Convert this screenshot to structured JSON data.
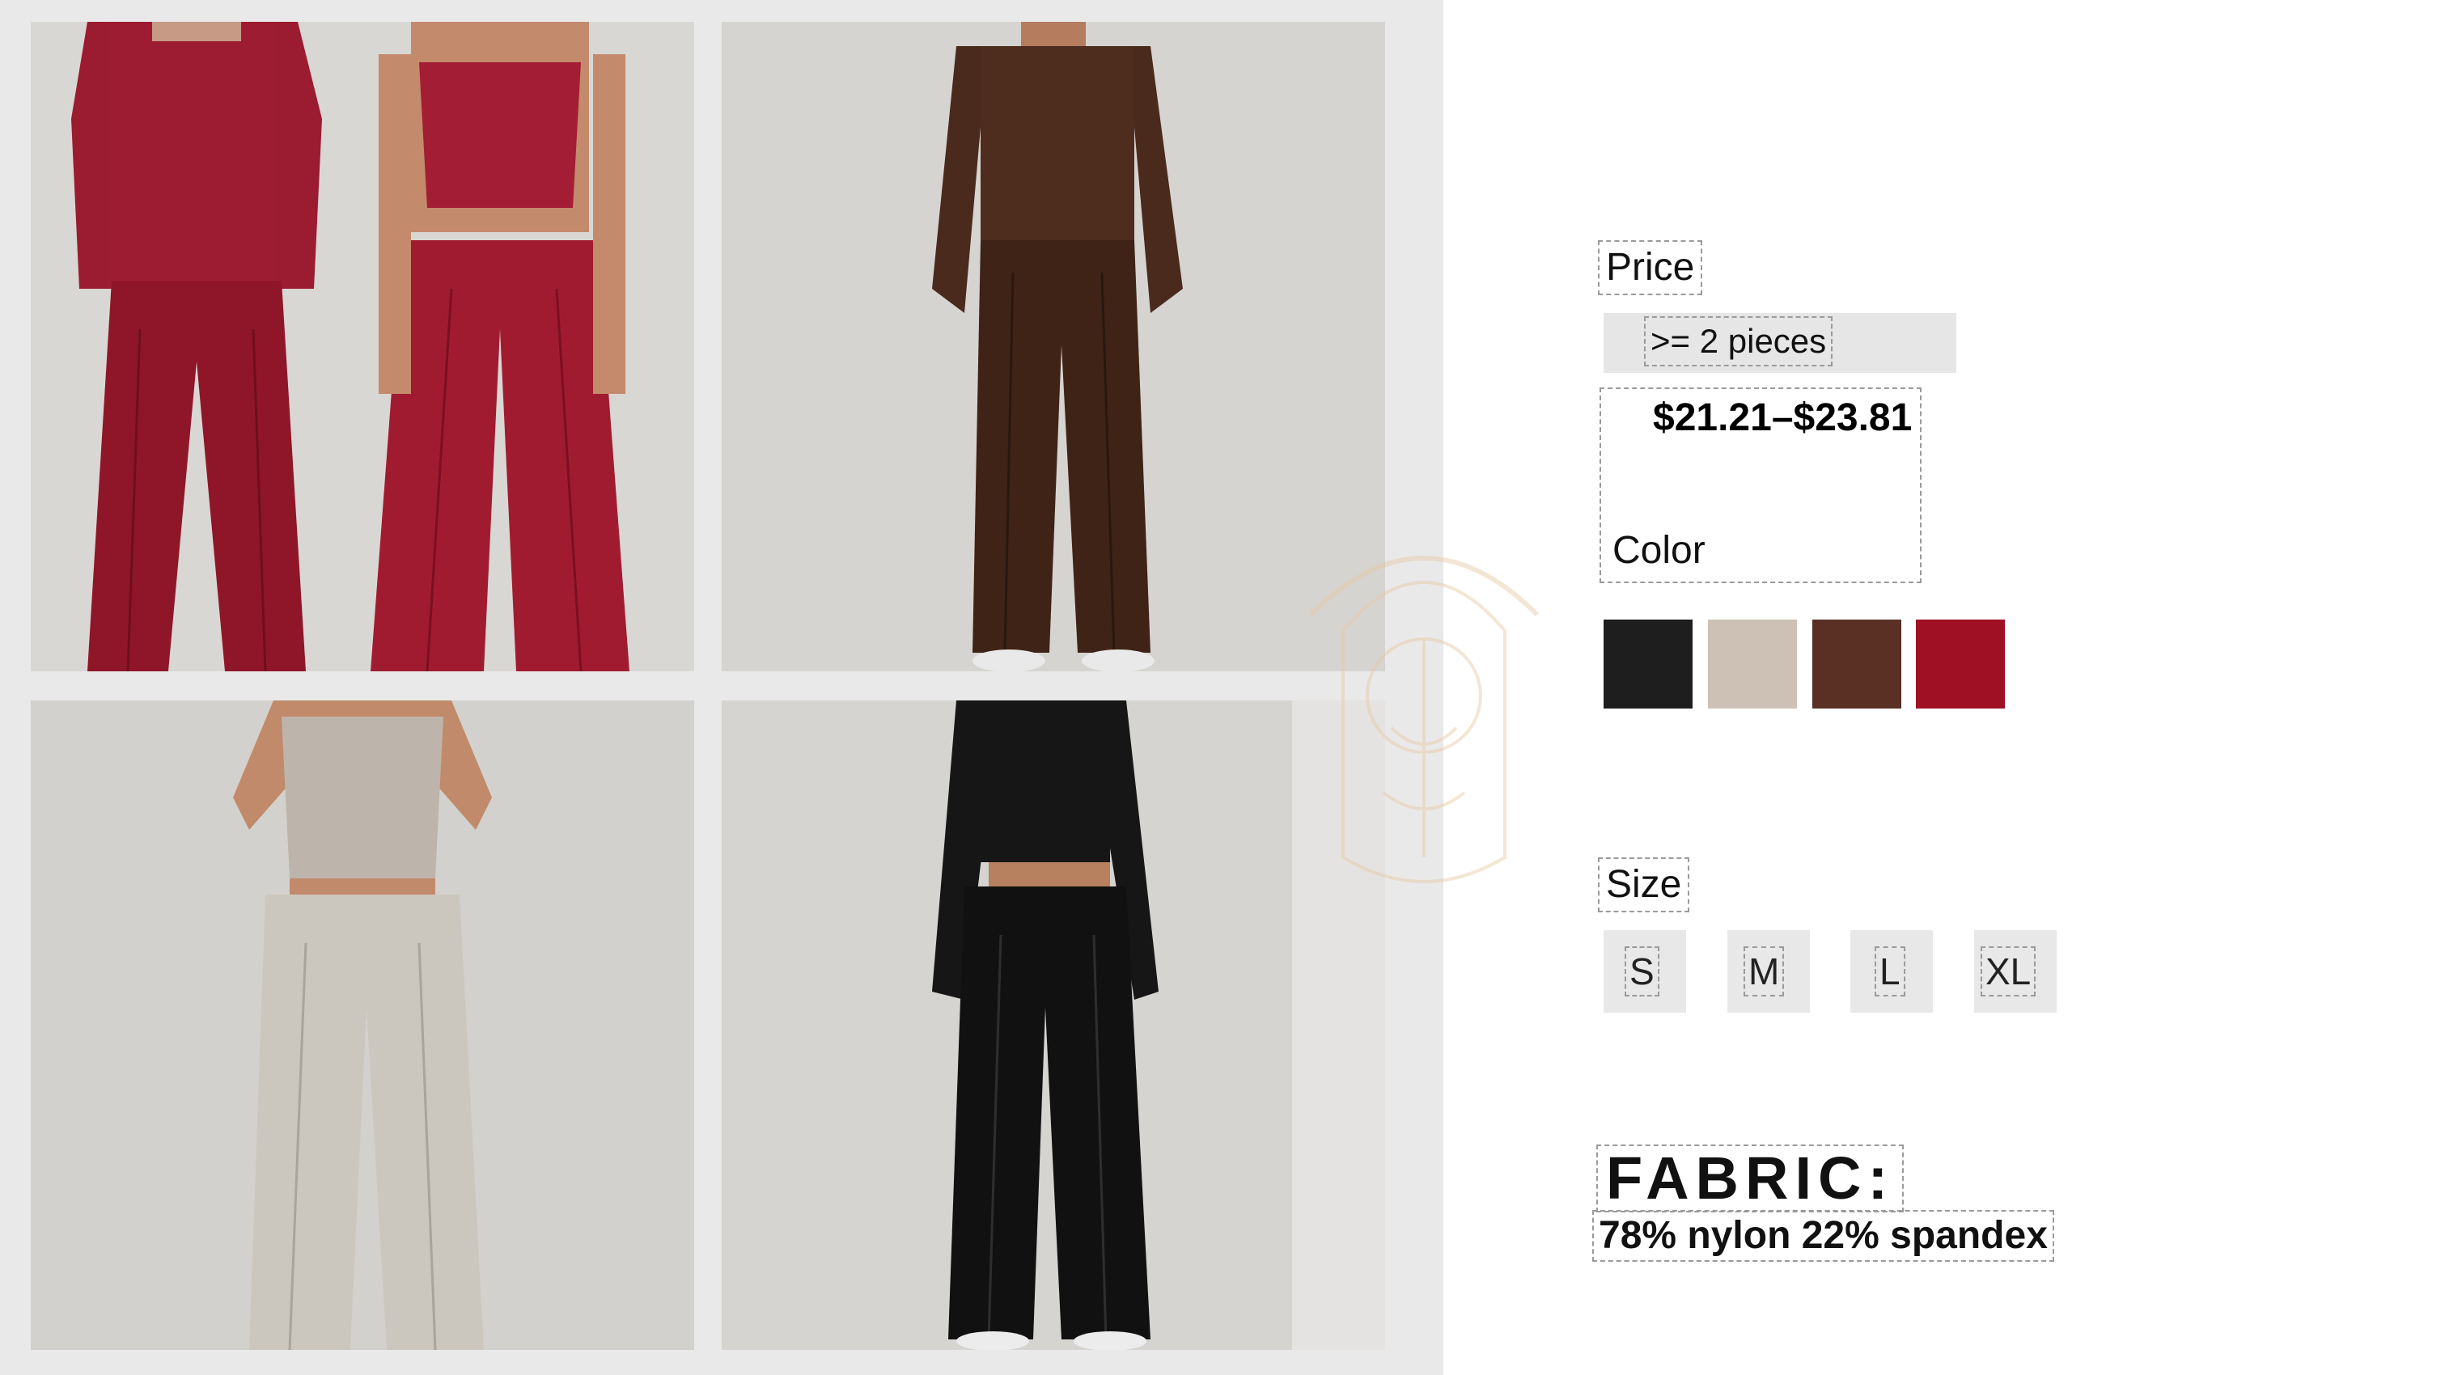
{
  "gallery": {
    "photos": [
      {
        "name": "wine-red-sweatshirt-and-tank-sets",
        "color": "#9b1b30"
      },
      {
        "name": "brown-sweatshirt-set",
        "color": "#4a2a1c"
      },
      {
        "name": "light-gray-tank-set",
        "color": "#cfcbc4"
      },
      {
        "name": "black-long-sleeve-set",
        "color": "#161616"
      }
    ]
  },
  "price": {
    "label": "Price",
    "tier_label": ">= 2 pieces",
    "range": "$21.21–$23.81"
  },
  "color": {
    "label": "Color",
    "swatches": [
      "#1e1e1e",
      "#cdc1b5",
      "#5a3024",
      "#a01025"
    ]
  },
  "size": {
    "label": "Size",
    "options": [
      "S",
      "M",
      "L",
      "XL"
    ]
  },
  "fabric": {
    "title": "FABRIC:",
    "composition": "78% nylon 22% spandex"
  }
}
